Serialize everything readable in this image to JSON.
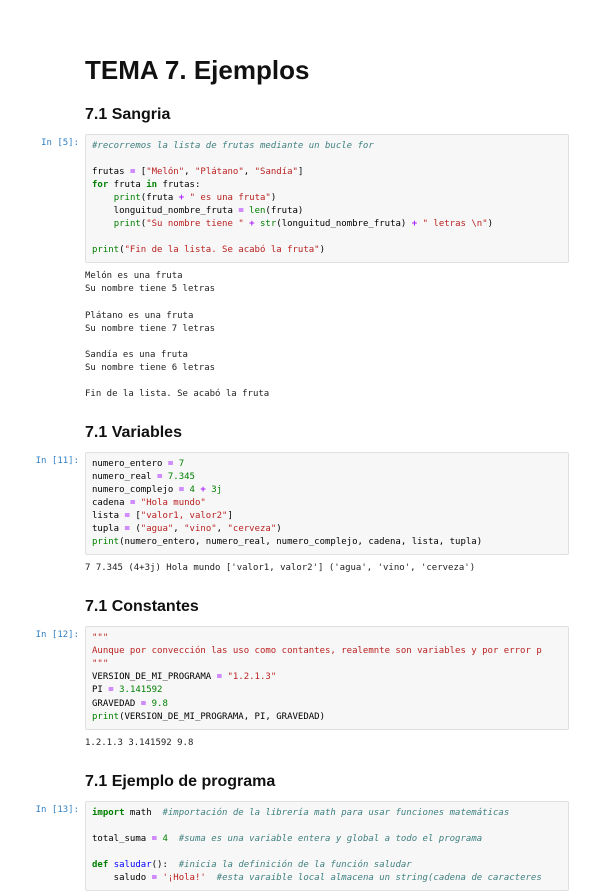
{
  "title": "TEMA 7. Ejemplos",
  "sections": {
    "s1": {
      "heading": "7.1 Sangria"
    },
    "s2": {
      "heading": "7.1 Variables"
    },
    "s3": {
      "heading": "7.1 Constantes"
    },
    "s4": {
      "heading": "7.1 Ejemplo de programa"
    }
  },
  "cells": {
    "c5": {
      "prompt": "In [5]:",
      "code": {
        "l1_comment": "#recorremos la lista de frutas mediante un bucle for",
        "l3a": "frutas ",
        "l3op": "=",
        "l3b": " [",
        "l3s1": "\"Melón\"",
        "l3c": ", ",
        "l3s2": "\"Plátano\"",
        "l3d": ", ",
        "l3s3": "\"Sandía\"",
        "l3e": "]",
        "l4kw": "for",
        "l4a": " fruta ",
        "l4op": "in",
        "l4b": " frutas:",
        "l5a": "    ",
        "l5fn": "print",
        "l5b": "(fruta ",
        "l5op": "+",
        "l5c": " ",
        "l5s": "\" es una fruta\"",
        "l5d": ")",
        "l6a": "    longuitud_nombre_fruta ",
        "l6op": "=",
        "l6b": " ",
        "l6fn": "len",
        "l6c": "(fruta)",
        "l7a": "    ",
        "l7fn": "print",
        "l7b": "(",
        "l7s1": "\"Su nombre tiene \"",
        "l7c": " ",
        "l7op1": "+",
        "l7d": " ",
        "l7fn2": "str",
        "l7e": "(longuitud_nombre_fruta) ",
        "l7op2": "+",
        "l7f": " ",
        "l7s2": "\" letras \\n\"",
        "l7g": ")",
        "l9fn": "print",
        "l9a": "(",
        "l9s": "\"Fin de la lista. Se acabó la fruta\"",
        "l9b": ")"
      },
      "output": "Melón es una fruta\nSu nombre tiene 5 letras \n\nPlátano es una fruta\nSu nombre tiene 7 letras \n\nSandía es una fruta\nSu nombre tiene 6 letras \n\nFin de la lista. Se acabó la fruta"
    },
    "c11": {
      "prompt": "In [11]:",
      "code": {
        "l1a": "numero_entero ",
        "l1op": "=",
        "l1b": " ",
        "l1n": "7",
        "l2a": "numero_real ",
        "l2op": "=",
        "l2b": " ",
        "l2n": "7.345",
        "l3a": "numero_complejo ",
        "l3op": "=",
        "l3b": " ",
        "l3n1": "4",
        "l3c": " ",
        "l3op2": "+",
        "l3d": " ",
        "l3n2": "3j",
        "l4a": "cadena ",
        "l4op": "=",
        "l4b": " ",
        "l4s": "\"Hola mundo\"",
        "l5a": "lista ",
        "l5op": "=",
        "l5b": " [",
        "l5s": "\"valor1, valor2\"",
        "l5c": "]",
        "l6a": "tupla ",
        "l6op": "=",
        "l6b": " (",
        "l6s1": "\"agua\"",
        "l6c": ", ",
        "l6s2": "\"vino\"",
        "l6d": ", ",
        "l6s3": "\"cerveza\"",
        "l6e": ")",
        "l7fn": "print",
        "l7a": "(numero_entero, numero_real, numero_complejo, cadena, lista, tupla)"
      },
      "output": "7 7.345 (4+3j) Hola mundo ['valor1, valor2'] ('agua', 'vino', 'cerveza')"
    },
    "c12": {
      "prompt": "In [12]:",
      "code": {
        "l1s": "\"\"\"",
        "l2s": "Aunque por convección las uso como contantes, realemnte son variables y por error p",
        "l3s": "\"\"\"",
        "l4a": "VERSION_DE_MI_PROGRAMA ",
        "l4op": "=",
        "l4b": " ",
        "l4s": "\"1.2.1.3\"",
        "l5a": "PI ",
        "l5op": "=",
        "l5b": " ",
        "l5n": "3.141592",
        "l6a": "GRAVEDAD ",
        "l6op": "=",
        "l6b": " ",
        "l6n": "9.8",
        "l7fn": "print",
        "l7a": "(VERSION_DE_MI_PROGRAMA, PI, GRAVEDAD)"
      },
      "output": "1.2.1.3 3.141592 9.8"
    },
    "c13": {
      "prompt": "In [13]:",
      "code": {
        "l1kw": "import",
        "l1a": " math  ",
        "l1c": "#importación de la librería math para usar funciones matemáticas",
        "l3a": "total_suma ",
        "l3op": "=",
        "l3b": " ",
        "l3n": "4",
        "l3c": "  ",
        "l3cm": "#suma es una variable entera y global a todo el programa",
        "l5kw": "def",
        "l5a": " ",
        "l5fn": "saludar",
        "l5b": "():  ",
        "l5cm": "#inicia la definición de la función saludar",
        "l6a": "    saludo ",
        "l6op": "=",
        "l6b": " ",
        "l6s": "'¡Hola!'",
        "l6c": "  ",
        "l6cm": "#esta varaible local almacena un string(cadena de caracteres"
      }
    }
  }
}
